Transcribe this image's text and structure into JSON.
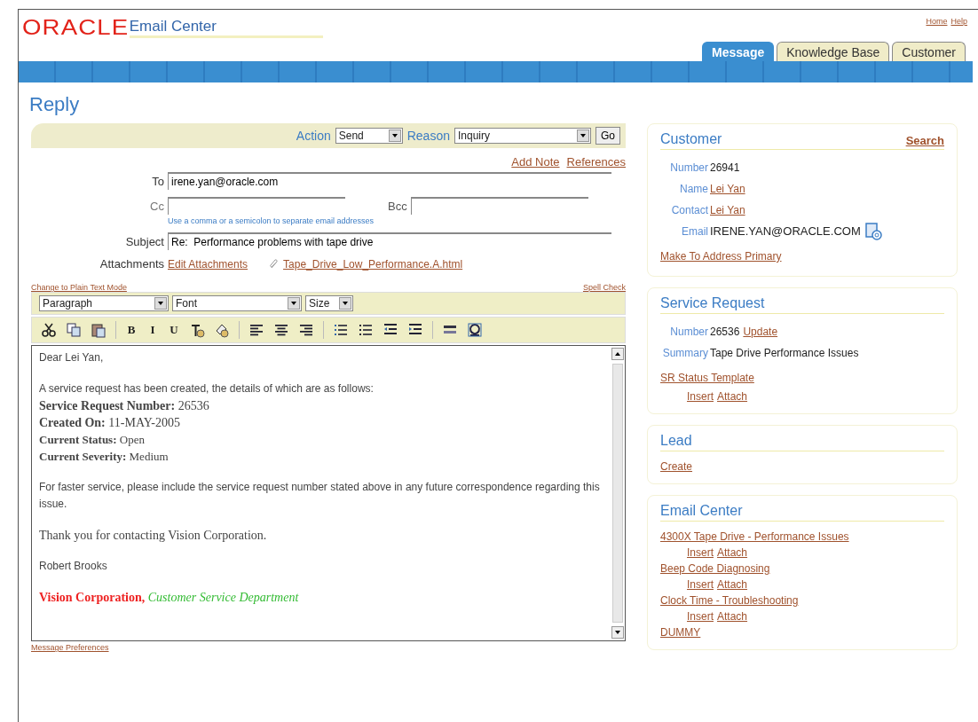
{
  "header": {
    "logo": "ORACLE",
    "app_title": "Email Center",
    "global_links": [
      "Home",
      "Help"
    ]
  },
  "tabs": [
    {
      "label": "Message",
      "selected": true
    },
    {
      "label": "Knowledge Base",
      "selected": false
    },
    {
      "label": "Customer",
      "selected": false
    }
  ],
  "page_title": "Reply",
  "action_bar": {
    "action_label": "Action",
    "action_value": "Send",
    "reason_label": "Reason",
    "reason_value": "Inquiry",
    "go": "Go"
  },
  "compose_links": [
    "Add Note",
    "References"
  ],
  "to": {
    "label": "To",
    "value": "irene.yan@oracle.com"
  },
  "cc": {
    "label": "Cc"
  },
  "bcc": {
    "label": "Bcc"
  },
  "address_hint": "Use a comma or a semicolon to separate email addresses",
  "subject": {
    "label": "Subject",
    "value": "Re:  Performance problems with tape drive"
  },
  "attachments": {
    "label": "Attachments",
    "edit_link": "Edit Attachments",
    "file": "Tape_Drive_Low_Performance.A.html"
  },
  "editor": {
    "mode_link": "Change to Plain Text Mode",
    "spell_link": "Spell Check",
    "selects": [
      "Paragraph",
      "Font",
      "Size"
    ],
    "tools": [
      {
        "kind": "cut"
      },
      {
        "kind": "copy"
      },
      {
        "kind": "paste"
      },
      {
        "kind": "sep"
      },
      {
        "kind": "glyph",
        "label": "B"
      },
      {
        "kind": "glyph",
        "label": "I"
      },
      {
        "kind": "glyph",
        "label": "U"
      },
      {
        "kind": "text-color"
      },
      {
        "kind": "highlight"
      },
      {
        "kind": "sep"
      },
      {
        "kind": "align-left"
      },
      {
        "kind": "align-center"
      },
      {
        "kind": "align-right"
      },
      {
        "kind": "sep"
      },
      {
        "kind": "ordered-list"
      },
      {
        "kind": "bullet-list"
      },
      {
        "kind": "outdent"
      },
      {
        "kind": "indent"
      },
      {
        "kind": "sep"
      },
      {
        "kind": "rule"
      },
      {
        "kind": "special"
      }
    ],
    "paragraphs": [
      {
        "lines": [
          {
            "kind": "sans",
            "text": "Dear Lei Yan,"
          }
        ]
      },
      {
        "lines": [
          {
            "kind": "sans",
            "text": "A service request has been created, the details of which are as follows:"
          },
          {
            "kind": "serif",
            "text": "**Service Request Number:** 26536"
          },
          {
            "kind": "serif",
            "text": "**Created On:** 11-MAY-2005"
          },
          {
            "kind": "serif-small",
            "text": "**Current Status:** Open"
          },
          {
            "kind": "serif-small",
            "text": "**Current Severity:** Medium"
          }
        ]
      },
      {
        "lines": [
          {
            "kind": "sans",
            "text": "For faster service, please include the service request number stated above in any future correspondence regarding this issue."
          }
        ]
      },
      {
        "lines": [
          {
            "kind": "serif",
            "text": "Thank you for contacting Vision Corporation."
          }
        ]
      },
      {
        "lines": [
          {
            "kind": "sans",
            "text": "Robert Brooks"
          }
        ]
      },
      {
        "lines": [
          {
            "kind": "signature",
            "company": "Vision Corporation,",
            "department": "Customer Service Department"
          }
        ]
      }
    ],
    "prefs_link": "Message Preferences"
  },
  "panels": [
    {
      "title": "Customer",
      "action": "Search",
      "rows": [
        {
          "label": "Number",
          "value": "26941",
          "kind": "text"
        },
        {
          "label": "Name",
          "value": "Lei Yan",
          "kind": "link"
        },
        {
          "label": "Contact",
          "value": "Lei Yan",
          "kind": "link"
        },
        {
          "label": "Email",
          "value": "IRENE.YAN@ORACLE.COM",
          "kind": "email"
        }
      ],
      "links": [
        {
          "text": "Make To Address Primary"
        }
      ]
    },
    {
      "title": "Service Request",
      "rows": [
        {
          "label": "Number",
          "value": "26536",
          "kind": "text",
          "link": "Update"
        },
        {
          "label": "Summary",
          "value": "Tape Drive Performance Issues",
          "kind": "text"
        }
      ],
      "links": [
        {
          "text": "SR Status Template",
          "subs": [
            "Insert",
            "Attach"
          ]
        }
      ]
    },
    {
      "title": "Lead",
      "links": [
        {
          "text": "Create"
        }
      ]
    },
    {
      "title": "Email Center",
      "links": [
        {
          "text": "4300X Tape Drive - Performance Issues",
          "subs": [
            "Insert",
            "Attach"
          ]
        },
        {
          "text": "Beep Code Diagnosing",
          "subs": [
            "Insert",
            "Attach"
          ]
        },
        {
          "text": "Clock Time - Troubleshooting",
          "subs": [
            "Insert",
            "Attach"
          ]
        },
        {
          "text": "DUMMY"
        }
      ]
    }
  ]
}
